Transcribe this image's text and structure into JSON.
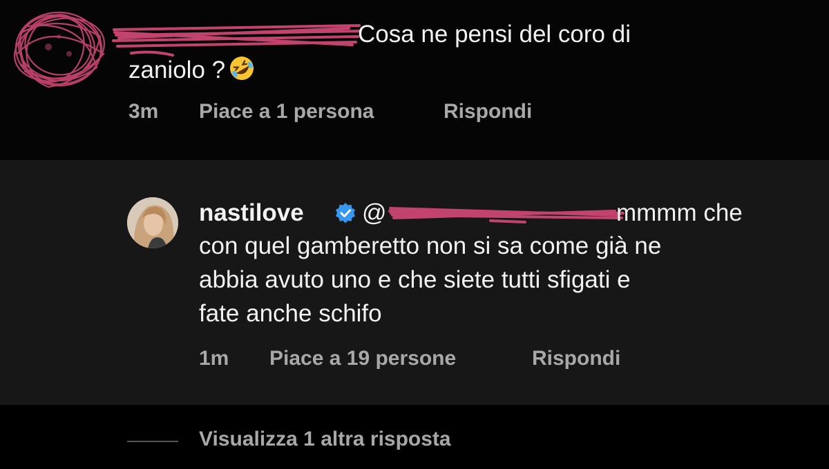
{
  "comment": {
    "text_line1": "Cosa ne pensi del coro di",
    "text_line2": "zaniolo ?",
    "emoji_icon": "rolling-on-floor-laughing-emoji",
    "time": "3m",
    "likes": "Piace a 1 persona",
    "reply_label": "Rispondi"
  },
  "reply": {
    "username": "nastilove",
    "verified_icon": "verified-badge-icon",
    "mention_prefix": "@",
    "text_line1": "mmmm che",
    "text_lines": [
      "con quel gamberetto non si sa come già ne",
      "abbia avuto uno e che siete tutti sfigati e",
      "fate anche schifo"
    ],
    "time": "1m",
    "likes": "Piace a 19 persone",
    "reply_label": "Rispondi"
  },
  "footer": {
    "view_more": "Visualizza 1 altra risposta"
  },
  "colors": {
    "background": "#000000",
    "reply_background": "#171717",
    "text_primary": "#f2f2f2",
    "text_secondary": "#a8a8a8",
    "redaction_scribble": "#c2446e",
    "verified_blue": "#3897f0"
  }
}
